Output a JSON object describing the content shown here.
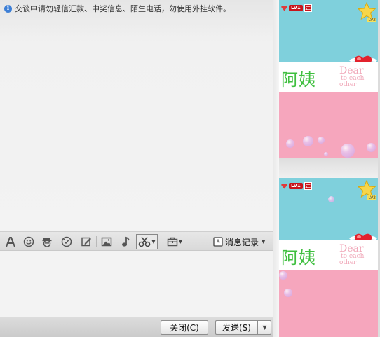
{
  "notice": {
    "icon": "info-icon",
    "text": "交谈中请勿轻信汇款、中奖信息、陌生电话，勿使用外挂软件。"
  },
  "toolbar": {
    "icons": [
      "font-icon",
      "emoji-icon",
      "magic-face-icon",
      "shake-icon",
      "doodle-icon",
      "image-icon",
      "music-icon",
      "scissors-icon",
      "toolbox-icon"
    ],
    "history_label": "消息记录"
  },
  "footer": {
    "close_label": "关闭(C)",
    "send_label": "发送(S)"
  },
  "show_panels": [
    {
      "level_badge": "LV1",
      "year_badge": "年",
      "star_level": "LV2",
      "name": "阿姨",
      "slogan_main": "Dear",
      "slogan_sub1": "to each",
      "slogan_sub2": "other"
    },
    {
      "level_badge": "LV1",
      "year_badge": "年",
      "star_level": "LV2",
      "name": "阿姨",
      "slogan_main": "Dear",
      "slogan_sub1": "to each",
      "slogan_sub2": "other"
    }
  ],
  "colors": {
    "sky": "#7fd0dc",
    "pink": "#f6a6bd",
    "name_green": "#3fbf3f",
    "badge_red": "#c8151b"
  }
}
